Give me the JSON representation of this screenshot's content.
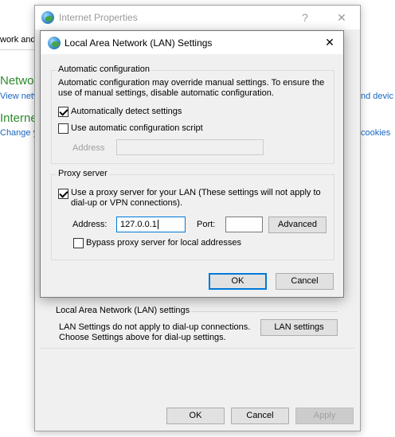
{
  "background": {
    "tab_fragment": "work and",
    "network_heading": "Networ",
    "network_link": "View netw",
    "internet_heading": "Interne",
    "internet_link": "Change y",
    "right_link_1": "nd devic",
    "right_link_2": "cookies"
  },
  "ip_window": {
    "title": "Internet Properties",
    "help_glyph": "?",
    "close_glyph": "✕",
    "lan_group_title": "Local Area Network (LAN) settings",
    "lan_info_line1": "LAN Settings do not apply to dial-up connections.",
    "lan_info_line2": "Choose Settings above for dial-up settings.",
    "lan_settings_button": "LAN settings",
    "buttons": {
      "ok": "OK",
      "cancel": "Cancel",
      "apply": "Apply"
    }
  },
  "lan_dialog": {
    "title": "Local Area Network (LAN) Settings",
    "close_glyph": "✕",
    "auto_config": {
      "group_title": "Automatic configuration",
      "description_line1": "Automatic configuration may override manual settings.  To ensure the",
      "description_line2": "use of manual settings, disable automatic configuration.",
      "auto_detect_label": "Automatically detect settings",
      "auto_detect_checked": true,
      "use_script_label": "Use automatic configuration script",
      "use_script_checked": false,
      "address_label": "Address",
      "address_value": ""
    },
    "proxy": {
      "group_title": "Proxy server",
      "use_proxy_label_line1": "Use a proxy server for your LAN (These settings will not apply to",
      "use_proxy_label_line2": "dial-up or VPN connections).",
      "use_proxy_checked": true,
      "address_label": "Address:",
      "address_value": "127.0.0.1",
      "port_label": "Port:",
      "port_value": "",
      "advanced_button": "Advanced",
      "bypass_label": "Bypass proxy server for local addresses",
      "bypass_checked": false
    },
    "buttons": {
      "ok": "OK",
      "cancel": "Cancel"
    }
  }
}
